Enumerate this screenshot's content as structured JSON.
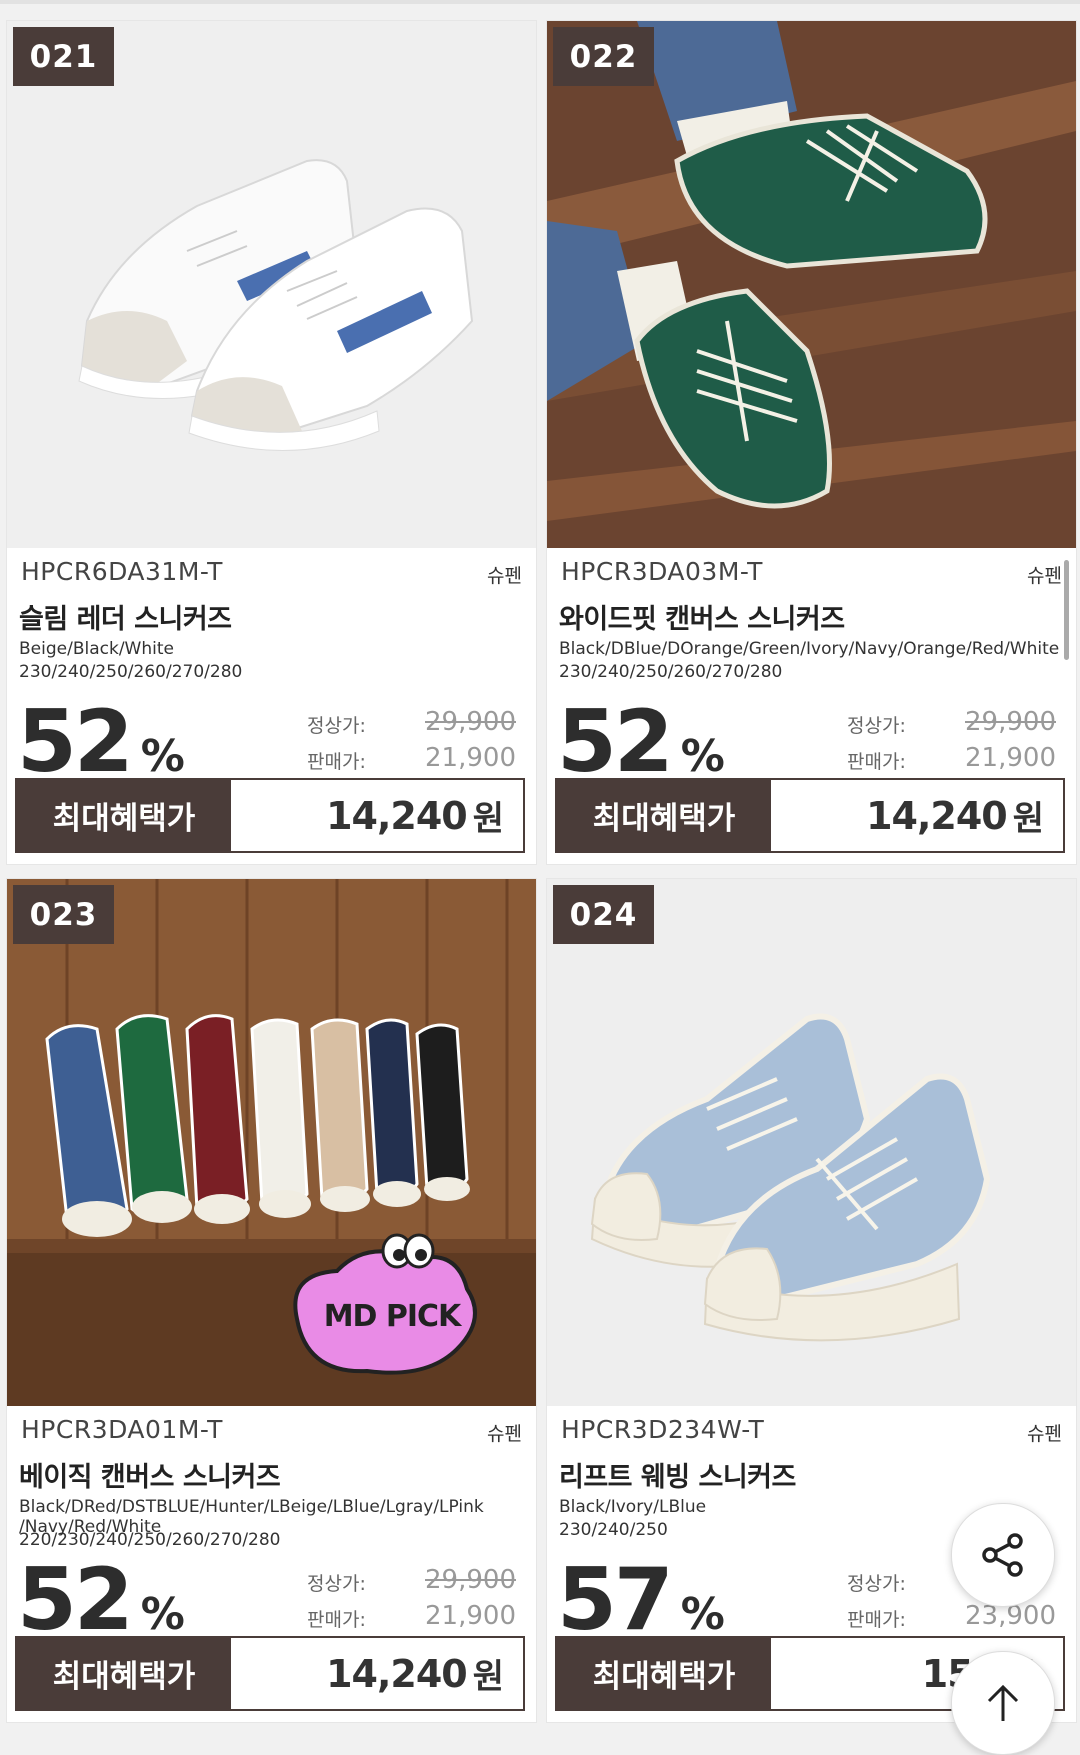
{
  "products": [
    {
      "number": "021",
      "code": "HPCR6DA31M-T",
      "brand": "슈펜",
      "name": "슬림 레더 스니커즈",
      "colors": "Beige/Black/White",
      "sizes": "230/240/250/260/270/280",
      "discount": "52",
      "percent_sign": "%",
      "regular_label": "정상가:",
      "regular_price": "29,900",
      "sale_label": "판매가:",
      "sale_price": "21,900",
      "benefit_label": "최대혜택가",
      "benefit_price": "14,240",
      "currency": "원"
    },
    {
      "number": "022",
      "code": "HPCR3DA03M-T",
      "brand": "슈펜",
      "name": "와이드핏 캔버스 스니커즈",
      "colors": "Black/DBlue/DOrange/Green/Ivory/Navy/Orange/Red/White",
      "sizes": "230/240/250/260/270/280",
      "discount": "52",
      "percent_sign": "%",
      "regular_label": "정상가:",
      "regular_price": "29,900",
      "sale_label": "판매가:",
      "sale_price": "21,900",
      "benefit_label": "최대혜택가",
      "benefit_price": "14,240",
      "currency": "원"
    },
    {
      "number": "023",
      "code": "HPCR3DA01M-T",
      "brand": "슈펜",
      "name": "베이직 캔버스 스니커즈",
      "colors": "Black/DRed/DSTBLUE/Hunter/LBeige/LBlue/Lgray/LPink /Navy/Red/White",
      "sizes": "220/230/240/250/260/270/280",
      "badge": "MD PICK",
      "discount": "52",
      "percent_sign": "%",
      "regular_label": "정상가:",
      "regular_price": "29,900",
      "sale_label": "판매가:",
      "sale_price": "21,900",
      "benefit_label": "최대혜택가",
      "benefit_price": "14,240",
      "currency": "원"
    },
    {
      "number": "024",
      "code": "HPCR3D234W-T",
      "brand": "슈펜",
      "name": "리프트 웨빙 스니커즈",
      "colors": "Black/Ivory/LBlue",
      "sizes": "230/240/250",
      "discount": "57",
      "percent_sign": "%",
      "regular_label": "정상가:",
      "regular_price": "",
      "sale_label": "판매가:",
      "sale_price": "23,900",
      "benefit_label": "최대혜택가",
      "benefit_price": "15,54",
      "currency": ""
    }
  ],
  "floating_buttons": {
    "share_icon": "share-icon",
    "top_icon": "arrow-up-icon"
  },
  "colors": {
    "tag_bg": "#4a3c39",
    "badge_pink": "#e98be6"
  }
}
